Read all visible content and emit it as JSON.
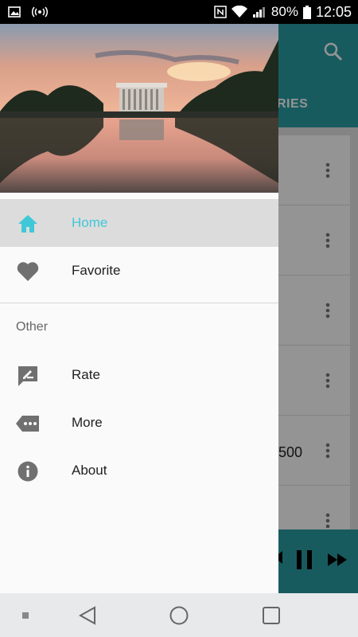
{
  "status_bar": {
    "battery_percent": "80%",
    "time": "12:05"
  },
  "background_app": {
    "tab_label": "RIES",
    "row_fragment": "500",
    "row_count": 6
  },
  "drawer": {
    "items_primary": [
      {
        "label": "Home",
        "icon": "home-icon",
        "active": true
      },
      {
        "label": "Favorite",
        "icon": "heart-icon",
        "active": false
      }
    ],
    "section_title": "Other",
    "items_other": [
      {
        "label": "Rate",
        "icon": "rate-icon"
      },
      {
        "label": "More",
        "icon": "more-icon"
      },
      {
        "label": "About",
        "icon": "info-icon"
      }
    ]
  },
  "colors": {
    "accent": "#3fc8d8",
    "toolbar": "#2a9da4",
    "icon_gray": "#707070"
  }
}
